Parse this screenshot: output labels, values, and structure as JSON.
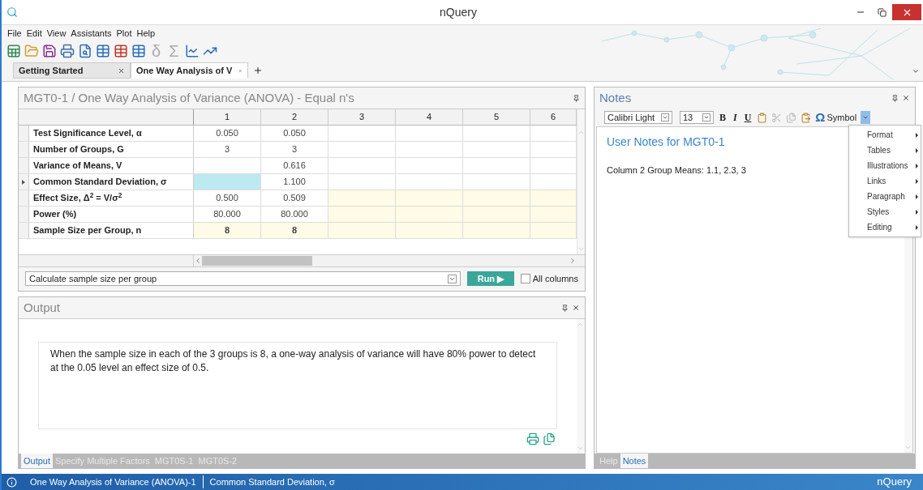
{
  "window": {
    "title": "nQuery"
  },
  "menu": [
    "File",
    "Edit",
    "View",
    "Assistants",
    "Plot",
    "Help"
  ],
  "toolbar_symbols": [
    "δ",
    "Σ"
  ],
  "tabs": [
    {
      "label": "Getting Started",
      "selected": false
    },
    {
      "label": "One Way Analysis of V",
      "selected": true
    }
  ],
  "design_panel": {
    "title": "MGT0-1 / One Way Analysis of Variance (ANOVA) - Equal n's",
    "columns": [
      "1",
      "2",
      "3",
      "4",
      "5",
      "6"
    ],
    "rows": [
      {
        "label": "Test Significance Level, α",
        "selected": false,
        "cells": [
          {
            "text": "0.050",
            "kind": "plain"
          },
          {
            "text": "0.050",
            "kind": "plain"
          },
          {
            "text": "",
            "kind": "plain"
          },
          {
            "text": "",
            "kind": "plain"
          },
          {
            "text": "",
            "kind": "plain"
          },
          {
            "text": "",
            "kind": "plain"
          }
        ]
      },
      {
        "label": "Number of Groups, G",
        "selected": false,
        "cells": [
          {
            "text": "3",
            "kind": "plain"
          },
          {
            "text": "3",
            "kind": "plain"
          },
          {
            "text": "",
            "kind": "plain"
          },
          {
            "text": "",
            "kind": "plain"
          },
          {
            "text": "",
            "kind": "plain"
          },
          {
            "text": "",
            "kind": "plain"
          }
        ]
      },
      {
        "label": "Variance of Means, V",
        "selected": false,
        "cells": [
          {
            "text": "",
            "kind": "plain"
          },
          {
            "text": "0.616",
            "kind": "plain"
          },
          {
            "text": "",
            "kind": "plain"
          },
          {
            "text": "",
            "kind": "plain"
          },
          {
            "text": "",
            "kind": "plain"
          },
          {
            "text": "",
            "kind": "plain"
          }
        ]
      },
      {
        "label": "Common Standard Deviation, σ",
        "selected": true,
        "cells": [
          {
            "text": "",
            "kind": "current"
          },
          {
            "text": "1.100",
            "kind": "plain"
          },
          {
            "text": "",
            "kind": "plain"
          },
          {
            "text": "",
            "kind": "plain"
          },
          {
            "text": "",
            "kind": "plain"
          },
          {
            "text": "",
            "kind": "plain"
          }
        ]
      },
      {
        "label": "Effect Size, Δ$^{2}$ = V/σ$^{2}$",
        "selected": false,
        "cells": [
          {
            "text": "0.500",
            "kind": "plain"
          },
          {
            "text": "0.509",
            "kind": "plain"
          },
          {
            "text": "",
            "kind": "shaded"
          },
          {
            "text": "",
            "kind": "shaded"
          },
          {
            "text": "",
            "kind": "shaded"
          },
          {
            "text": "",
            "kind": "shaded"
          }
        ]
      },
      {
        "label": "Power (%)",
        "selected": false,
        "cells": [
          {
            "text": "80.000",
            "kind": "plain"
          },
          {
            "text": "80.000",
            "kind": "plain"
          },
          {
            "text": "",
            "kind": "shaded"
          },
          {
            "text": "",
            "kind": "shaded"
          },
          {
            "text": "",
            "kind": "shaded"
          },
          {
            "text": "",
            "kind": "shaded"
          }
        ]
      },
      {
        "label": "Sample Size per Group, n",
        "selected": false,
        "cells": [
          {
            "text": "8",
            "kind": "result"
          },
          {
            "text": "8",
            "kind": "result"
          },
          {
            "text": "",
            "kind": "shaded"
          },
          {
            "text": "",
            "kind": "shaded"
          },
          {
            "text": "",
            "kind": "shaded"
          },
          {
            "text": "",
            "kind": "shaded"
          }
        ]
      }
    ],
    "calculation": {
      "value": "Calculate sample size per group"
    },
    "run_button": {
      "label": "Run ▶"
    },
    "all_columns": {
      "label": "All columns",
      "checked": false
    }
  },
  "output_panel": {
    "title": "Output",
    "text": "When the sample size in each of the 3 groups is 8, a one-way analysis of variance will have 80% power to detect at the 0.05 level an effect size of 0.5.",
    "tabs": [
      {
        "label": "Output",
        "selected": true
      },
      {
        "label": "Specify Multiple Factors",
        "selected": false
      },
      {
        "label": "MGT0S-1",
        "selected": false
      },
      {
        "label": "MGT0S-2",
        "selected": false
      }
    ]
  },
  "notes_panel": {
    "title": "Notes",
    "font": "Calibri Light",
    "size": "13",
    "format_buttons": [
      "B",
      "I",
      "U"
    ],
    "symbol_glyph": "Ω",
    "symbol_label": "Symbol",
    "heading": "User Notes for MGT0-1",
    "body": "Column 2 Group Means: 1.1, 2.3, 3",
    "menu": [
      "Format",
      "Tables",
      "Illustrations",
      "Links",
      "Paragraph",
      "Styles",
      "Editing"
    ],
    "tabs": [
      {
        "label": "Help",
        "selected": false
      },
      {
        "label": "Notes",
        "selected": true
      }
    ]
  },
  "status_bar": {
    "items": [
      "One Way Analysis of Variance (ANOVA)-1",
      "Common Standard Deviation, σ"
    ],
    "logo": "nQuery"
  }
}
